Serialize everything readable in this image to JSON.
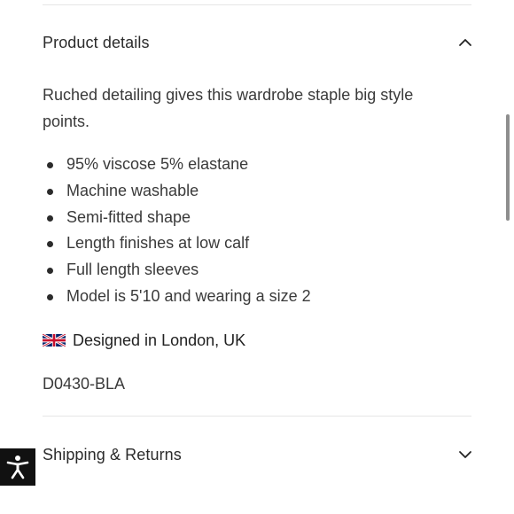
{
  "product_details": {
    "title": "Product details",
    "expanded": true,
    "chevron_icon": "chevron-up-icon",
    "description": "Ruched detailing gives this wardrobe staple big style points.",
    "bullets": [
      "95% viscose 5% elastane",
      "Machine washable",
      "Semi-fitted shape",
      "Length finishes at low calf",
      "Full length sleeves",
      "Model is 5'10 and wearing a size 2"
    ],
    "origin": {
      "flag_icon": "uk-flag-icon",
      "text": "Designed in London, UK"
    },
    "sku": "D0430-BLA"
  },
  "shipping_returns": {
    "title": "Shipping & Returns",
    "expanded": false,
    "chevron_icon": "chevron-down-icon"
  },
  "accessibility_widget": {
    "icon": "accessibility-icon",
    "background": "#111111"
  }
}
